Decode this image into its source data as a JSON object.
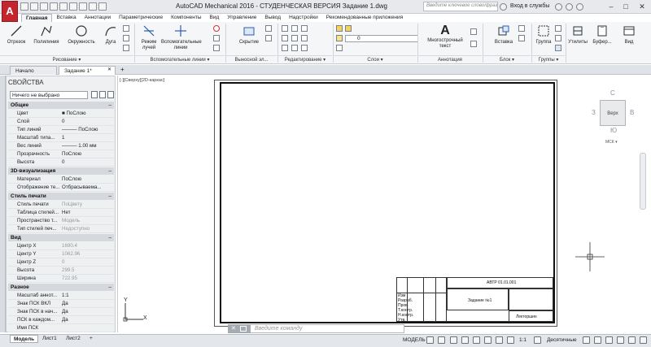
{
  "titlebar": {
    "app_logo": "A",
    "title": "AutoCAD Mechanical 2016 - СТУДЕНЧЕСКАЯ ВЕРСИЯ    Задание 1.dwg",
    "search_placeholder": "Введите ключевое слово/фразу",
    "login": "Вход в службы",
    "minimize": "–",
    "maximize": "□",
    "close": "✕"
  },
  "menu_tabs": [
    "Главная",
    "Вставка",
    "Аннотации",
    "Параметрические",
    "Компоненты",
    "Вид",
    "Управление",
    "Вывод",
    "Надстройки",
    "Рекомендованные приложения"
  ],
  "ribbon": {
    "draw": {
      "line": "Отрезок",
      "polyline": "Полилиния",
      "circle": "Окружность",
      "arc": "Дуга",
      "group": "Рисование ▾"
    },
    "aux": {
      "ray_mode": "Режим лучей",
      "aux_lines": "Вспомогательные линии",
      "group": "Вспомогательные линии ▾"
    },
    "hidden": {
      "label": "Скрытие",
      "group": "Выносной эл..."
    },
    "modify": {
      "group": "Редактирование ▾"
    },
    "layers": {
      "layer_value": "0",
      "group": "Слои ▾"
    },
    "annotation": {
      "mtext": "Многострочный текст",
      "group": "Аннотация"
    },
    "block": {
      "insert": "Вставка",
      "group": "Блок ▾"
    },
    "groups": {
      "label": "Группа",
      "group": "Группы ▾"
    },
    "utilities": "Утилиты",
    "clipboard": "Буфер...",
    "view": "Вид"
  },
  "doc_tabs": [
    "Начало",
    "Задание 1*"
  ],
  "doc_tab_close": "✕",
  "doc_tab_add": "+",
  "viewport_label": "[-][Сверху][2D-каркас]",
  "palette": {
    "title": "СВОЙСТВА",
    "selection": "Ничего не выбрано",
    "strip_label": "СВОЙСТВА",
    "sections": [
      {
        "title": "Общие",
        "rows": [
          {
            "k": "Цвет",
            "v": "■ ПоСлою",
            "dim": false
          },
          {
            "k": "Слой",
            "v": "0",
            "dim": false
          },
          {
            "k": "Тип линий",
            "v": "——— ПоСлою",
            "dim": false
          },
          {
            "k": "Масштаб типа...",
            "v": "1",
            "dim": false
          },
          {
            "k": "Вес линий",
            "v": "——— 1.00 мм",
            "dim": false
          },
          {
            "k": "Прозрачность",
            "v": "ПоСлою",
            "dim": false
          },
          {
            "k": "Высота",
            "v": "0",
            "dim": false
          }
        ]
      },
      {
        "title": "3D-визуализация",
        "rows": [
          {
            "k": "Материал",
            "v": "ПоСлою",
            "dim": false
          },
          {
            "k": "Отображение те...",
            "v": "Отбрасываема...",
            "dim": false
          }
        ]
      },
      {
        "title": "Стиль печати",
        "rows": [
          {
            "k": "Стиль печати",
            "v": "ПоЦвету",
            "dim": true
          },
          {
            "k": "Таблица стилей...",
            "v": "Нет",
            "dim": false
          },
          {
            "k": "Пространство т...",
            "v": "Модель",
            "dim": true
          },
          {
            "k": "Тип стилей печ...",
            "v": "Недоступно",
            "dim": true
          }
        ]
      },
      {
        "title": "Вид",
        "rows": [
          {
            "k": "Центр X",
            "v": "1690.4",
            "dim": true
          },
          {
            "k": "Центр Y",
            "v": "1062.96",
            "dim": true
          },
          {
            "k": "Центр Z",
            "v": "0",
            "dim": true
          },
          {
            "k": "Высота",
            "v": "299.5",
            "dim": true
          },
          {
            "k": "Ширина",
            "v": "722.95",
            "dim": true
          }
        ]
      },
      {
        "title": "Разное",
        "rows": [
          {
            "k": "Масштаб аннот...",
            "v": "1:1",
            "dim": false
          },
          {
            "k": "Знак ПСК ВКЛ",
            "v": "Да",
            "dim": false
          },
          {
            "k": "Знак ПСК в нач...",
            "v": "Да",
            "dim": false
          },
          {
            "k": "ПСК в каждом...",
            "v": "Да",
            "dim": false
          },
          {
            "k": "Имя ПСК",
            "v": "",
            "dim": false
          }
        ]
      }
    ]
  },
  "viewcube": {
    "face": "Верх",
    "north": "С",
    "south": "Ю",
    "east": "В",
    "west": "З",
    "wcs": "МСК ▾"
  },
  "ucs": {
    "x": "X",
    "y": "Y"
  },
  "title_block": {
    "code": "АВТР 01.01.001",
    "name": "Задание №1",
    "org": "Лекторшин",
    "rows": [
      "Изм",
      "Разраб.",
      "Пров.",
      "Т.контр.",
      "Н.контр.",
      "Утв."
    ]
  },
  "command_line": {
    "placeholder": "Введите команду",
    "close": "✕"
  },
  "layout_tabs": [
    "Модель",
    "Лист1",
    "Лист2"
  ],
  "layout_add": "+",
  "statusbar": {
    "model": "МОДЕЛЬ",
    "decimal": "Десятичные",
    "scale": "1:1"
  }
}
